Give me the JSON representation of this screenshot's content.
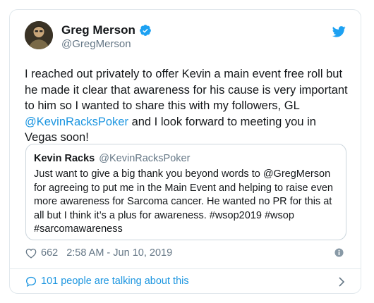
{
  "author": {
    "name": "Greg Merson",
    "handle": "@GregMerson"
  },
  "tweet": {
    "text_part1": "I reached out privately to offer Kevin a main event free roll but he made it clear that awareness for his cause is very important to him so I wanted to share this with my followers, GL ",
    "mention": "@KevinRacksPoker",
    "text_part2": " and I look forward to meeting you in Vegas soon!"
  },
  "quoted_tweet": {
    "name": "Kevin Racks",
    "handle": "@KevinRacksPoker",
    "text": "Just want to give a big thank you beyond words to @GregMerson for agreeing to put me in the Main Event and helping to raise even more awareness for Sarcoma cancer. He wanted no PR for this at all but I think it’s a plus for awareness.   #wsop2019 #wsop #sarcomawareness"
  },
  "meta": {
    "likes": "662",
    "timestamp": "2:58 AM - Jun 10, 2019"
  },
  "footer": {
    "talking_label": "101 people are talking about this"
  },
  "icons": {
    "verified": "verified-badge-icon",
    "twitter": "twitter-bird-icon",
    "like": "heart-icon",
    "info": "info-icon",
    "talking": "speech-bubble-icon",
    "chevron": "chevron-right-icon"
  },
  "colors": {
    "brand_blue": "#1da1f2",
    "link_blue": "#1b95e0",
    "secondary_text": "#657786",
    "border": "#e1e8ed"
  }
}
